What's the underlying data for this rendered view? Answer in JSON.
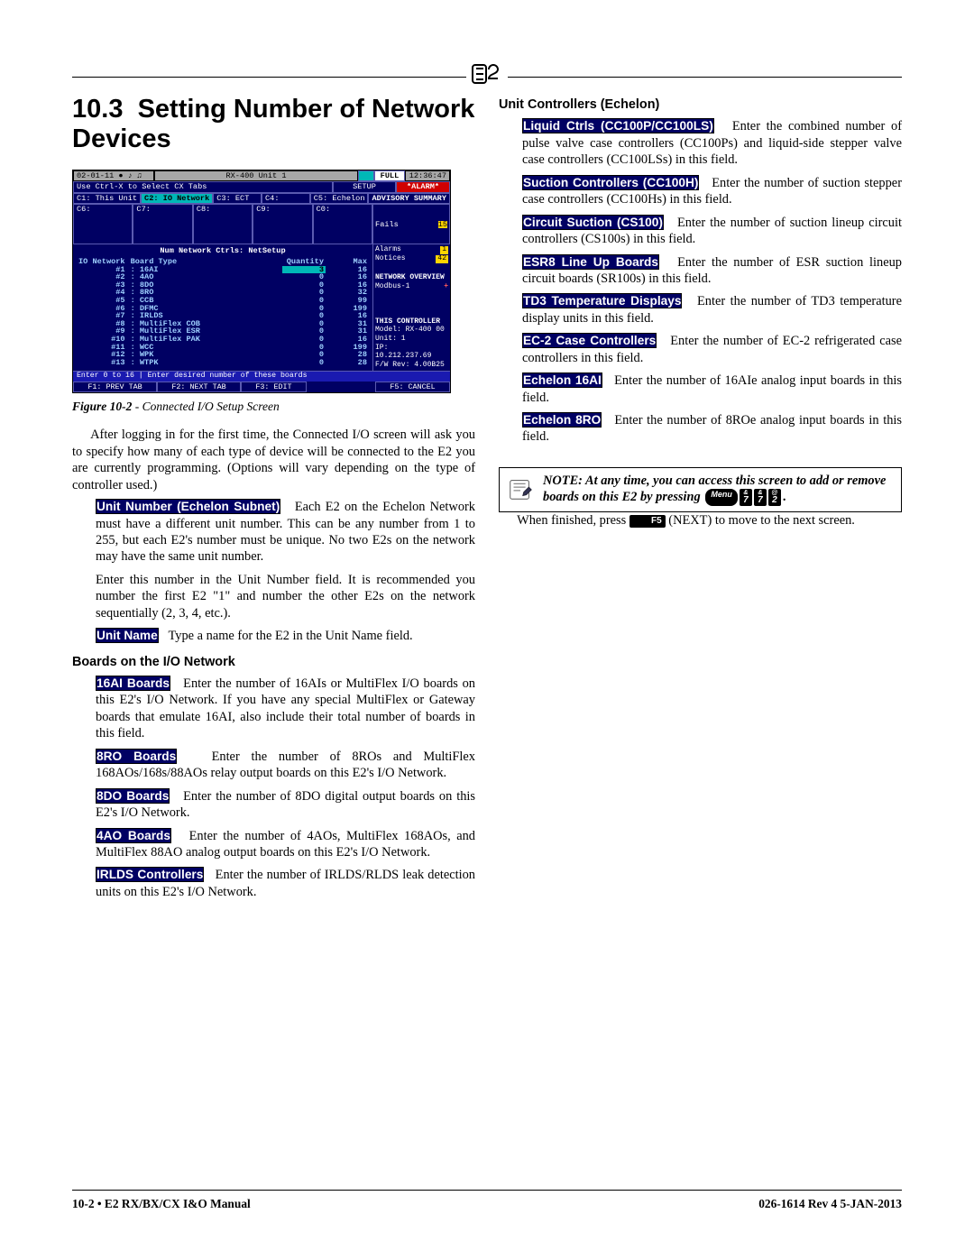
{
  "header_logo_alt": "E2",
  "section_number": "10.3",
  "section_title": "Setting Number of Network Devices",
  "figure": {
    "label": "Figure 10-2",
    "caption": " - Connected I/O Setup Screen"
  },
  "intro_para": "After logging in for the first time, the Connected I/O screen will ask you to specify how many of each type of device will be connected to the E2 you are currently programming. (Options will vary depending on the type of controller used.)",
  "left_items": [
    {
      "term": "Unit Number (Echelon Subnet)",
      "desc": "Each E2 on the Echelon Network must have a different unit number. This can be any number from 1 to 255, but each E2's number must be unique. No two E2s on the network may have the same unit number."
    },
    {
      "term": "",
      "desc": "Enter this number in the Unit Number field. It is recommended you number the first E2 \"1\" and number the other E2s on the network sequentially (2, 3, 4, etc.)."
    },
    {
      "term": "Unit Name",
      "desc": "Type a name for the E2 in the Unit Name field."
    }
  ],
  "left_subhead": "Boards on the I/O Network",
  "left_boards": [
    {
      "term": "16AI Boards",
      "desc": "Enter the number of 16AIs or MultiFlex I/O boards on this E2's I/O Network. If you have any special MultiFlex or Gateway boards that emulate 16AI, also include their total number of boards in this field."
    },
    {
      "term": "8RO Boards",
      "desc": "Enter the number of 8ROs and MultiFlex 168AOs/168s/88AOs relay output boards on this E2's I/O Network."
    },
    {
      "term": "8DO Boards",
      "desc": "Enter the number of 8DO digital output boards on this E2's I/O Network."
    },
    {
      "term": "4AO Boards",
      "desc": "Enter the number of 4AOs, MultiFlex 168AOs, and MultiFlex 88AO analog output boards on this E2's I/O Network."
    },
    {
      "term": "IRLDS Controllers",
      "desc": "Enter the number of IRLDS/RLDS leak detection units on this E2's I/O Network."
    }
  ],
  "right_subhead": "Unit Controllers (Echelon)",
  "right_items": [
    {
      "term": "Liquid Ctrls (CC100P/CC100LS)",
      "desc": "Enter the combined number of pulse valve case controllers (CC100Ps) and liquid-side stepper valve case controllers (CC100LSs) in this field."
    },
    {
      "term": "Suction Controllers (CC100H)",
      "desc": "Enter the number of suction stepper case controllers (CC100Hs) in this field."
    },
    {
      "term": "Circuit Suction (CS100)",
      "desc": "Enter the number of suction lineup circuit controllers (CS100s) in this field."
    },
    {
      "term": "ESR8 Line Up Boards",
      "desc": "Enter the number of ESR suction lineup circuit boards (SR100s) in this field."
    },
    {
      "term": "TD3 Temperature Displays",
      "desc": "Enter the number of TD3 temperature display units in this field."
    },
    {
      "term": "EC-2 Case Controllers",
      "desc": "Enter the number of EC-2 refrigerated case controllers in this field."
    },
    {
      "term": "Echelon 16AI",
      "desc": "Enter the number of 16AIe analog input boards in this field."
    },
    {
      "term": "Echelon 8RO",
      "desc": "Enter the number of 8ROe analog input boards in this field."
    }
  ],
  "note": {
    "text_line1": "NOTE: At any time, you can access this screen to add or remove boards on this E2 by pressing",
    "keys": [
      "Menu",
      "&|7",
      "&|7",
      "@|2"
    ],
    "trail": "."
  },
  "after_note_pre": "When finished, press ",
  "after_note_key": "F5",
  "after_note_post": " (NEXT) to move to the next screen.",
  "footer_left": "10-2 • E2 RX/BX/CX I&O Manual",
  "footer_right": "026-1614 Rev 4 5-JAN-2013",
  "terminal": {
    "top_left": "02-01-11 ● ♪ ♫",
    "top_center": "RX-400 Unit 1",
    "top_full": "FULL",
    "top_time": "12:36:47",
    "alarm": "*ALARM*",
    "hint": "Use Ctrl-X to Select CX Tabs",
    "setup": "SETUP",
    "tabs": [
      "C1: This Unit",
      "C2: IO Network",
      "C3: ECT",
      "C4:",
      "C5: Echelon",
      "C6:",
      "C7:",
      "C8:",
      "C9:",
      "C0:"
    ],
    "body_title": "Num Network Ctrls: NetSetup",
    "table_head": [
      "IO Network",
      "Board Type",
      "Quantity",
      "Max"
    ],
    "rows": [
      [
        "#1",
        ": 16AI",
        "3",
        "16"
      ],
      [
        "#2",
        ": 4AO",
        "0",
        "16"
      ],
      [
        "#3",
        ": 8DO",
        "0",
        "16"
      ],
      [
        "#4",
        ": 8RO",
        "0",
        "32"
      ],
      [
        "#5",
        ": CCB",
        "0",
        "99"
      ],
      [
        "#6",
        ": DFMC",
        "0",
        "199"
      ],
      [
        "#7",
        ": IRLDS",
        "0",
        "16"
      ],
      [
        "#8",
        ": MultiFlex COB",
        "0",
        "31"
      ],
      [
        "#9",
        ": MultiFlex ESR",
        "0",
        "31"
      ],
      [
        "#10",
        ": MultiFlex PAK",
        "0",
        "16"
      ],
      [
        "#11",
        ": WCC",
        "0",
        "199"
      ],
      [
        "#12",
        ": WPK",
        "0",
        "28"
      ],
      [
        "#13",
        ": WTPK",
        "0",
        "28"
      ]
    ],
    "side": {
      "adv_title": "ADVISORY SUMMARY",
      "fails": {
        "label": "Fails",
        "val": "15"
      },
      "alarms": {
        "label": "Alarms",
        "val": "1"
      },
      "notices": {
        "label": "Notices",
        "val": "42"
      },
      "net_title": "NETWORK OVERVIEW",
      "modbus": "Modbus-1",
      "ctrl_title": "THIS CONTROLLER",
      "model": "Model: RX-400   00",
      "unit": "Unit: 1",
      "ip": "IP: 10.212.237.69",
      "fw": "F/W Rev: 4.00B25"
    },
    "prompt": "Enter 0 to 16 | Enter desired number of these boards",
    "fkeys": [
      "F1: PREV TAB",
      "F2: NEXT TAB",
      "F3: EDIT",
      "",
      "F5: CANCEL"
    ]
  }
}
